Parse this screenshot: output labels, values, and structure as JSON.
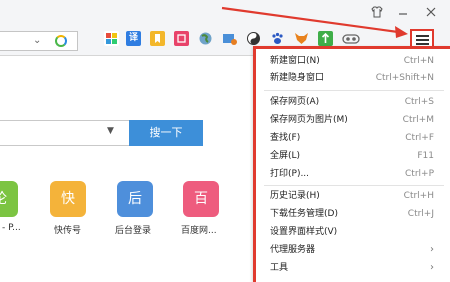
{
  "window": {
    "icons": [
      "shirt-icon",
      "minimize-icon",
      "close-icon"
    ]
  },
  "toolbar": {
    "extension_icons": [
      "grid-icon",
      "translate-icon",
      "bookmark-icon",
      "note-icon",
      "globe-icon",
      "screenshot-icon",
      "yinyang-icon",
      "paw-icon",
      "fox-icon",
      "upload-icon",
      "vr-icon"
    ],
    "translate_char": "译",
    "accent_color": "#e03a2e"
  },
  "page": {
    "search_button": "搜一下",
    "tiles": [
      {
        "char": "论",
        "label": "- P...",
        "color": "#7cc442"
      },
      {
        "char": "快",
        "label": "快传号",
        "color": "#f4b33a"
      },
      {
        "char": "后",
        "label": "后台登录",
        "color": "#4e8fdb"
      },
      {
        "char": "百",
        "label": "百度网...",
        "color": "#ee5c7e"
      }
    ]
  },
  "menu": {
    "items": [
      {
        "label": "新建窗口(N)",
        "shortcut": "Ctrl+N"
      },
      {
        "label": "新建隐身窗口",
        "shortcut": "Ctrl+Shift+N"
      },
      {
        "label": "保存网页(A)",
        "shortcut": "Ctrl+S"
      },
      {
        "label": "保存网页为图片(M)",
        "shortcut": "Ctrl+M"
      },
      {
        "label": "查找(F)",
        "shortcut": "Ctrl+F"
      },
      {
        "label": "全屏(L)",
        "shortcut": "F11"
      },
      {
        "label": "打印(P)...",
        "shortcut": "Ctrl+P"
      },
      {
        "label": "历史记录(H)",
        "shortcut": "Ctrl+H"
      },
      {
        "label": "下载任务管理(D)",
        "shortcut": "Ctrl+J"
      },
      {
        "label": "设置界面样式(V)",
        "shortcut": ""
      },
      {
        "label": "代理服务器",
        "shortcut": ""
      },
      {
        "label": "工具",
        "shortcut": ""
      }
    ]
  }
}
